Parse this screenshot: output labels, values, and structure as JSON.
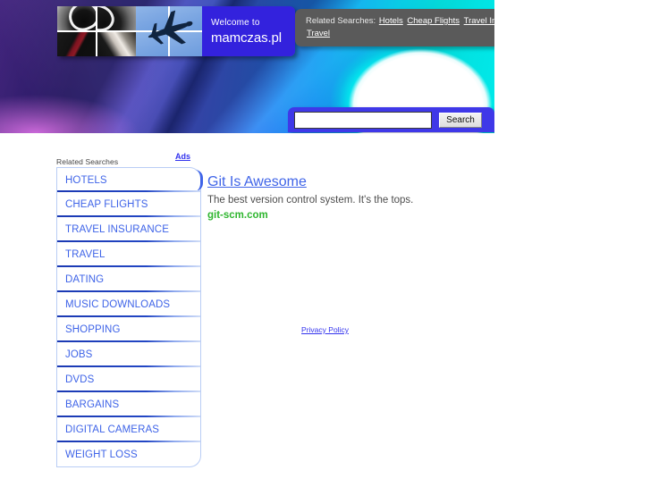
{
  "site": {
    "welcome_small": "Welcome to",
    "domain": "mamczas.pl"
  },
  "top_related": {
    "label": "Related Searches:",
    "links": [
      "Hotels",
      "Cheap Flights",
      "Travel Insurance",
      "Travel"
    ]
  },
  "search": {
    "value": "",
    "placeholder": "",
    "button_label": "Search"
  },
  "ads_column": {
    "heading": "Related Searches",
    "ads_link": "Ads",
    "items": [
      "HOTELS",
      "CHEAP FLIGHTS",
      "TRAVEL INSURANCE",
      "TRAVEL",
      "DATING",
      "MUSIC DOWNLOADS",
      "SHOPPING",
      "JOBS",
      "DVDS",
      "BARGAINS",
      "DIGITAL CAMERAS",
      "WEIGHT LOSS"
    ]
  },
  "results": [
    {
      "title": "Git Is Awesome",
      "description": "The best version control system. It's the tops.",
      "url": "git-scm.com"
    }
  ],
  "footer": {
    "privacy_label": "Privacy Policy"
  },
  "colors": {
    "brand_blue": "#3322dd",
    "link_blue": "#3f64e8",
    "url_green": "#2fb62f",
    "topbar_grey": "#5a5a5a",
    "search_panel": "#3f38e8"
  }
}
